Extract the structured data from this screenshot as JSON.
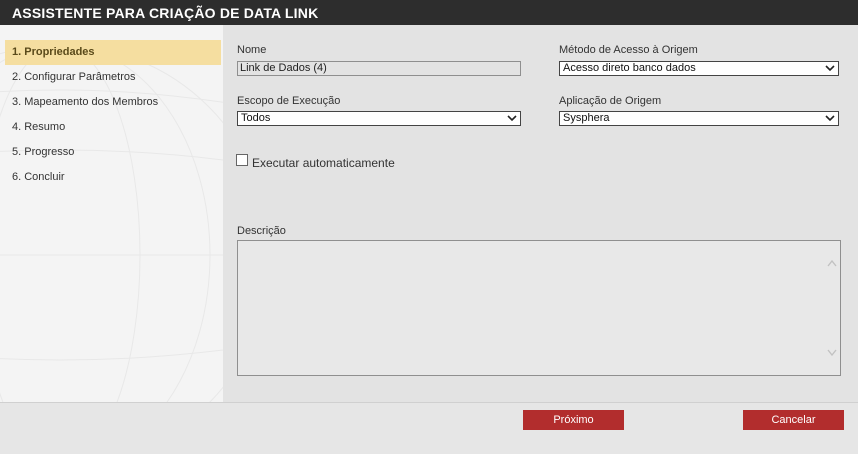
{
  "window": {
    "title": "ASSISTENTE PARA CRIAÇÃO DE DATA LINK"
  },
  "steps": [
    {
      "label": "1. Propriedades",
      "active": true
    },
    {
      "label": "2. Configurar Parâmetros",
      "active": false
    },
    {
      "label": "3. Mapeamento dos Membros",
      "active": false
    },
    {
      "label": "4. Resumo",
      "active": false
    },
    {
      "label": "5. Progresso",
      "active": false
    },
    {
      "label": "6. Concluir",
      "active": false
    }
  ],
  "form": {
    "name": {
      "label": "Nome",
      "value": "Link de Dados (4)"
    },
    "access_method": {
      "label": "Método de Acesso à Origem",
      "value": "Acesso direto banco dados"
    },
    "execution_scope": {
      "label": "Escopo de Execução",
      "value": "Todos"
    },
    "source_app": {
      "label": "Aplicação de Origem",
      "value": "Sysphera"
    },
    "auto_run": {
      "label": "Executar automaticamente",
      "checked": false
    },
    "description": {
      "label": "Descrição",
      "value": ""
    }
  },
  "footer": {
    "next_label": "Próximo",
    "cancel_label": "Cancelar"
  },
  "colors": {
    "titlebar": "#2d2d2d",
    "active_step": "#f5dea0",
    "button": "#b22d2d"
  }
}
